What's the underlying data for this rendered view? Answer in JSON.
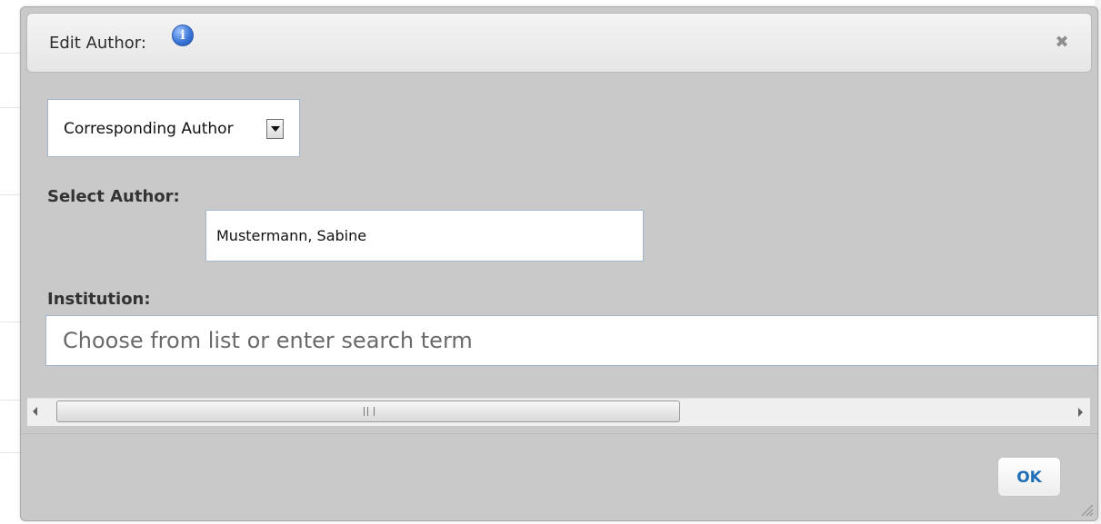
{
  "dialog": {
    "title": "Edit Author:",
    "close_icon": "close-icon",
    "info_icon": "info-icon"
  },
  "role_select": {
    "selected": "Corresponding Author"
  },
  "select_author": {
    "label": "Select Author:",
    "value": "Mustermann, Sabine"
  },
  "institution": {
    "label": "Institution:",
    "placeholder": "Choose from list or enter search term"
  },
  "footer": {
    "ok_label": "OK"
  },
  "colors": {
    "dialog_bg": "#c9c9c9",
    "accent": "#1f6fb7",
    "input_border": "#9fb6cd"
  }
}
